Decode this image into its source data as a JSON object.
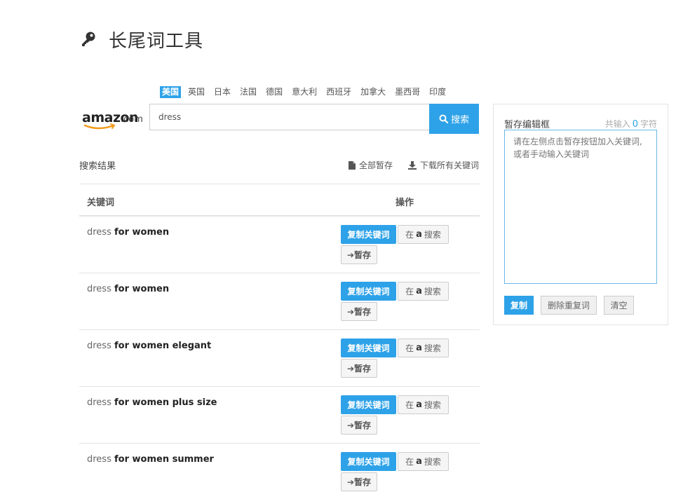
{
  "page": {
    "title": "长尾词工具",
    "title_icon": "key-icon"
  },
  "countries": [
    {
      "label": "美国",
      "active": true
    },
    {
      "label": "英国",
      "active": false
    },
    {
      "label": "日本",
      "active": false
    },
    {
      "label": "法国",
      "active": false
    },
    {
      "label": "德国",
      "active": false
    },
    {
      "label": "意大利",
      "active": false
    },
    {
      "label": "西班牙",
      "active": false
    },
    {
      "label": "加拿大",
      "active": false
    },
    {
      "label": "墨西哥",
      "active": false
    },
    {
      "label": "印度",
      "active": false
    }
  ],
  "logo": {
    "brand": "amazon",
    "suffix": ".com"
  },
  "search": {
    "value": "dress",
    "button_label": "搜索"
  },
  "results": {
    "title": "搜索结果",
    "save_all_label": "全部暂存",
    "download_all_label": "下载所有关键词",
    "col_keyword": "关键词",
    "col_action": "操作",
    "copy_label": "复制关键词",
    "az_prefix": "在",
    "az_glyph": "a",
    "az_suffix": "搜索",
    "save_label": "➔暂存",
    "rows": [
      {
        "base": "dress",
        "suffix": "for women"
      },
      {
        "base": "dress",
        "suffix": "for women"
      },
      {
        "base": "dress",
        "suffix": "for women elegant"
      },
      {
        "base": "dress",
        "suffix": "for women plus size"
      },
      {
        "base": "dress",
        "suffix": "for women summer"
      }
    ]
  },
  "side": {
    "title": "暂存编辑框",
    "count_prefix": "共输入",
    "count_value": "0",
    "count_suffix": "字符",
    "placeholder": "请在左侧点击暂存按钮加入关键词,\n或者手动输入关键词",
    "copy_label": "复制",
    "dedupe_label": "删除重复词",
    "clear_label": "清空"
  },
  "colors": {
    "accent": "#2ea2e8",
    "border": "#e3e3e3"
  }
}
